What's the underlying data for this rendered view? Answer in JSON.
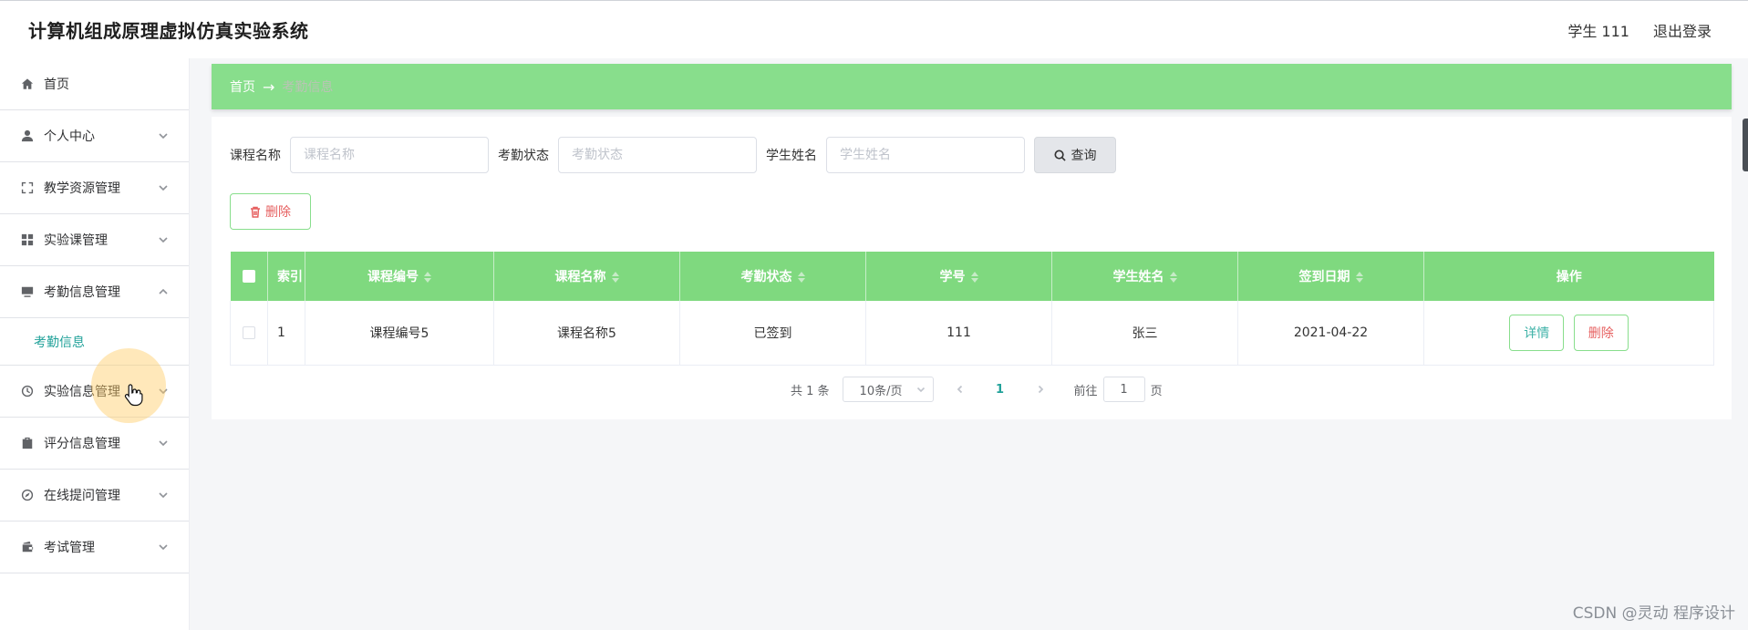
{
  "header": {
    "title": "计算机组成原理虚拟仿真实验系统",
    "user_label": "学生 111",
    "logout_label": "退出登录"
  },
  "sidebar": {
    "items": [
      {
        "label": "首页",
        "icon": "home-icon",
        "has_arrow": false
      },
      {
        "label": "个人中心",
        "icon": "user-icon",
        "has_arrow": true
      },
      {
        "label": "教学资源管理",
        "icon": "fullscreen-icon",
        "has_arrow": true
      },
      {
        "label": "实验课管理",
        "icon": "grid-icon",
        "has_arrow": true
      },
      {
        "label": "考勤信息管理",
        "icon": "monitor-icon",
        "has_arrow": true,
        "expanded": true
      },
      {
        "label": "实验信息管理",
        "icon": "clock-icon",
        "has_arrow": true
      },
      {
        "label": "评分信息管理",
        "icon": "clipboard-icon",
        "has_arrow": true
      },
      {
        "label": "在线提问管理",
        "icon": "compass-icon",
        "has_arrow": true
      },
      {
        "label": "考试管理",
        "icon": "wallet-icon",
        "has_arrow": true
      }
    ],
    "submenu": {
      "label": "考勤信息"
    }
  },
  "breadcrumb": {
    "home": "首页",
    "separator": "→",
    "current": "考勤信息"
  },
  "search": {
    "course_label": "课程名称",
    "course_placeholder": "课程名称",
    "status_label": "考勤状态",
    "status_placeholder": "考勤状态",
    "student_label": "学生姓名",
    "student_placeholder": "学生姓名",
    "query_label": "查询"
  },
  "actions": {
    "delete_label": "删除"
  },
  "table": {
    "headers": [
      "索引",
      "课程编号",
      "课程名称",
      "考勤状态",
      "学号",
      "学生姓名",
      "签到日期",
      "操作"
    ],
    "rows": [
      {
        "index": "1",
        "course_code": "课程编号5",
        "course_name": "课程名称5",
        "status": "已签到",
        "student_id": "111",
        "student_name": "张三",
        "sign_date": "2021-04-22",
        "detail_label": "详情",
        "delete_label": "删除"
      }
    ]
  },
  "pagination": {
    "total_text": "共 1 条",
    "page_size": "10条/页",
    "current_page": "1",
    "goto_label": "前往",
    "goto_value": "1",
    "page_suffix": "页"
  },
  "watermark": "CSDN @灵动 程序设计",
  "colors": {
    "accent_green": "#88de8c",
    "table_header_green": "#7fd97f",
    "teal_text": "#22a29a",
    "danger_red": "#e65f5f"
  }
}
